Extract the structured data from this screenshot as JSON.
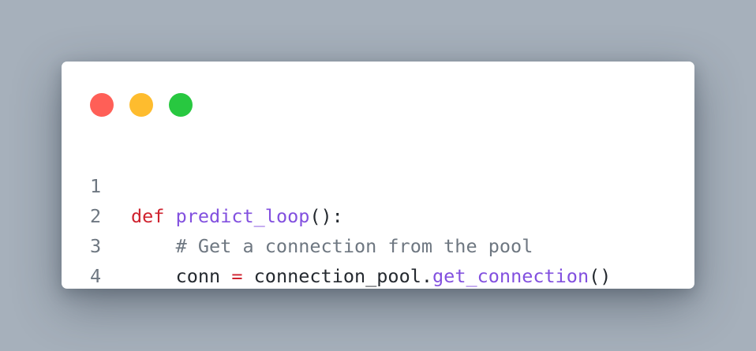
{
  "window": {
    "controls": [
      {
        "name": "close-button",
        "color": "#ff5f57"
      },
      {
        "name": "minimize-button",
        "color": "#febc2e"
      },
      {
        "name": "maximize-button",
        "color": "#28c840"
      }
    ]
  },
  "code": {
    "lines": [
      {
        "number": "1",
        "tokens": {
          "kw": "def",
          "sp1": " ",
          "fn": "predict_loop",
          "rest": "():"
        }
      },
      {
        "number": "2",
        "tokens": {
          "indent": "    ",
          "comment": "# Get a connection from the pool"
        }
      },
      {
        "number": "3",
        "tokens": {
          "indent": "    ",
          "var": "conn",
          "sp1": " ",
          "op": "=",
          "sp2": " ",
          "obj": "connection_pool.",
          "method": "get_connection",
          "rest": "()"
        }
      },
      {
        "number": "4"
      }
    ]
  },
  "colors": {
    "background": "#a6b0bb",
    "card": "#ffffff",
    "keyword": "#cf222e",
    "function": "#8250df",
    "comment": "#6e7781",
    "text": "#24292f"
  }
}
